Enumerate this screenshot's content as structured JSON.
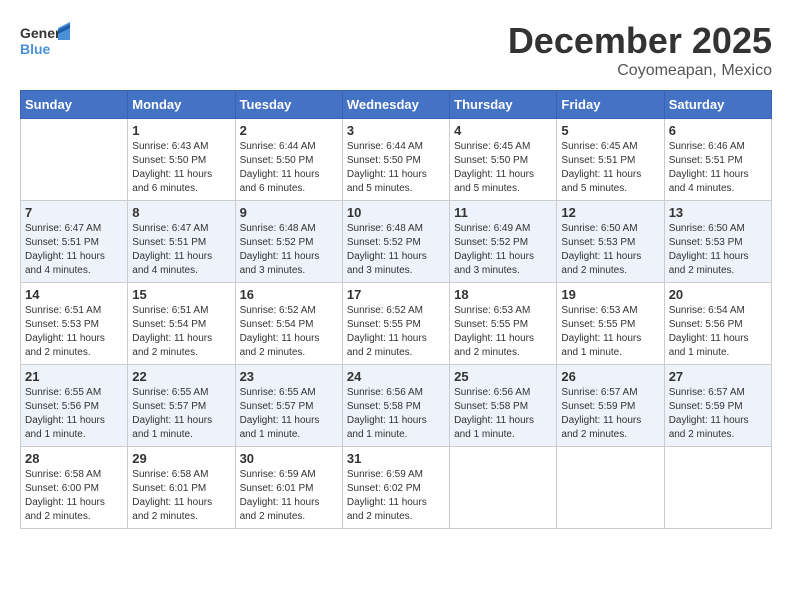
{
  "header": {
    "logo_general": "General",
    "logo_blue": "Blue",
    "month_title": "December 2025",
    "location": "Coyomeapan, Mexico"
  },
  "calendar": {
    "days_of_week": [
      "Sunday",
      "Monday",
      "Tuesday",
      "Wednesday",
      "Thursday",
      "Friday",
      "Saturday"
    ],
    "weeks": [
      [
        {
          "day": "",
          "info": ""
        },
        {
          "day": "1",
          "info": "Sunrise: 6:43 AM\nSunset: 5:50 PM\nDaylight: 11 hours\nand 6 minutes."
        },
        {
          "day": "2",
          "info": "Sunrise: 6:44 AM\nSunset: 5:50 PM\nDaylight: 11 hours\nand 6 minutes."
        },
        {
          "day": "3",
          "info": "Sunrise: 6:44 AM\nSunset: 5:50 PM\nDaylight: 11 hours\nand 5 minutes."
        },
        {
          "day": "4",
          "info": "Sunrise: 6:45 AM\nSunset: 5:50 PM\nDaylight: 11 hours\nand 5 minutes."
        },
        {
          "day": "5",
          "info": "Sunrise: 6:45 AM\nSunset: 5:51 PM\nDaylight: 11 hours\nand 5 minutes."
        },
        {
          "day": "6",
          "info": "Sunrise: 6:46 AM\nSunset: 5:51 PM\nDaylight: 11 hours\nand 4 minutes."
        }
      ],
      [
        {
          "day": "7",
          "info": "Sunrise: 6:47 AM\nSunset: 5:51 PM\nDaylight: 11 hours\nand 4 minutes."
        },
        {
          "day": "8",
          "info": "Sunrise: 6:47 AM\nSunset: 5:51 PM\nDaylight: 11 hours\nand 4 minutes."
        },
        {
          "day": "9",
          "info": "Sunrise: 6:48 AM\nSunset: 5:52 PM\nDaylight: 11 hours\nand 3 minutes."
        },
        {
          "day": "10",
          "info": "Sunrise: 6:48 AM\nSunset: 5:52 PM\nDaylight: 11 hours\nand 3 minutes."
        },
        {
          "day": "11",
          "info": "Sunrise: 6:49 AM\nSunset: 5:52 PM\nDaylight: 11 hours\nand 3 minutes."
        },
        {
          "day": "12",
          "info": "Sunrise: 6:50 AM\nSunset: 5:53 PM\nDaylight: 11 hours\nand 2 minutes."
        },
        {
          "day": "13",
          "info": "Sunrise: 6:50 AM\nSunset: 5:53 PM\nDaylight: 11 hours\nand 2 minutes."
        }
      ],
      [
        {
          "day": "14",
          "info": "Sunrise: 6:51 AM\nSunset: 5:53 PM\nDaylight: 11 hours\nand 2 minutes."
        },
        {
          "day": "15",
          "info": "Sunrise: 6:51 AM\nSunset: 5:54 PM\nDaylight: 11 hours\nand 2 minutes."
        },
        {
          "day": "16",
          "info": "Sunrise: 6:52 AM\nSunset: 5:54 PM\nDaylight: 11 hours\nand 2 minutes."
        },
        {
          "day": "17",
          "info": "Sunrise: 6:52 AM\nSunset: 5:55 PM\nDaylight: 11 hours\nand 2 minutes."
        },
        {
          "day": "18",
          "info": "Sunrise: 6:53 AM\nSunset: 5:55 PM\nDaylight: 11 hours\nand 2 minutes."
        },
        {
          "day": "19",
          "info": "Sunrise: 6:53 AM\nSunset: 5:55 PM\nDaylight: 11 hours\nand 1 minute."
        },
        {
          "day": "20",
          "info": "Sunrise: 6:54 AM\nSunset: 5:56 PM\nDaylight: 11 hours\nand 1 minute."
        }
      ],
      [
        {
          "day": "21",
          "info": "Sunrise: 6:55 AM\nSunset: 5:56 PM\nDaylight: 11 hours\nand 1 minute."
        },
        {
          "day": "22",
          "info": "Sunrise: 6:55 AM\nSunset: 5:57 PM\nDaylight: 11 hours\nand 1 minute."
        },
        {
          "day": "23",
          "info": "Sunrise: 6:55 AM\nSunset: 5:57 PM\nDaylight: 11 hours\nand 1 minute."
        },
        {
          "day": "24",
          "info": "Sunrise: 6:56 AM\nSunset: 5:58 PM\nDaylight: 11 hours\nand 1 minute."
        },
        {
          "day": "25",
          "info": "Sunrise: 6:56 AM\nSunset: 5:58 PM\nDaylight: 11 hours\nand 1 minute."
        },
        {
          "day": "26",
          "info": "Sunrise: 6:57 AM\nSunset: 5:59 PM\nDaylight: 11 hours\nand 2 minutes."
        },
        {
          "day": "27",
          "info": "Sunrise: 6:57 AM\nSunset: 5:59 PM\nDaylight: 11 hours\nand 2 minutes."
        }
      ],
      [
        {
          "day": "28",
          "info": "Sunrise: 6:58 AM\nSunset: 6:00 PM\nDaylight: 11 hours\nand 2 minutes."
        },
        {
          "day": "29",
          "info": "Sunrise: 6:58 AM\nSunset: 6:01 PM\nDaylight: 11 hours\nand 2 minutes."
        },
        {
          "day": "30",
          "info": "Sunrise: 6:59 AM\nSunset: 6:01 PM\nDaylight: 11 hours\nand 2 minutes."
        },
        {
          "day": "31",
          "info": "Sunrise: 6:59 AM\nSunset: 6:02 PM\nDaylight: 11 hours\nand 2 minutes."
        },
        {
          "day": "",
          "info": ""
        },
        {
          "day": "",
          "info": ""
        },
        {
          "day": "",
          "info": ""
        }
      ]
    ]
  }
}
